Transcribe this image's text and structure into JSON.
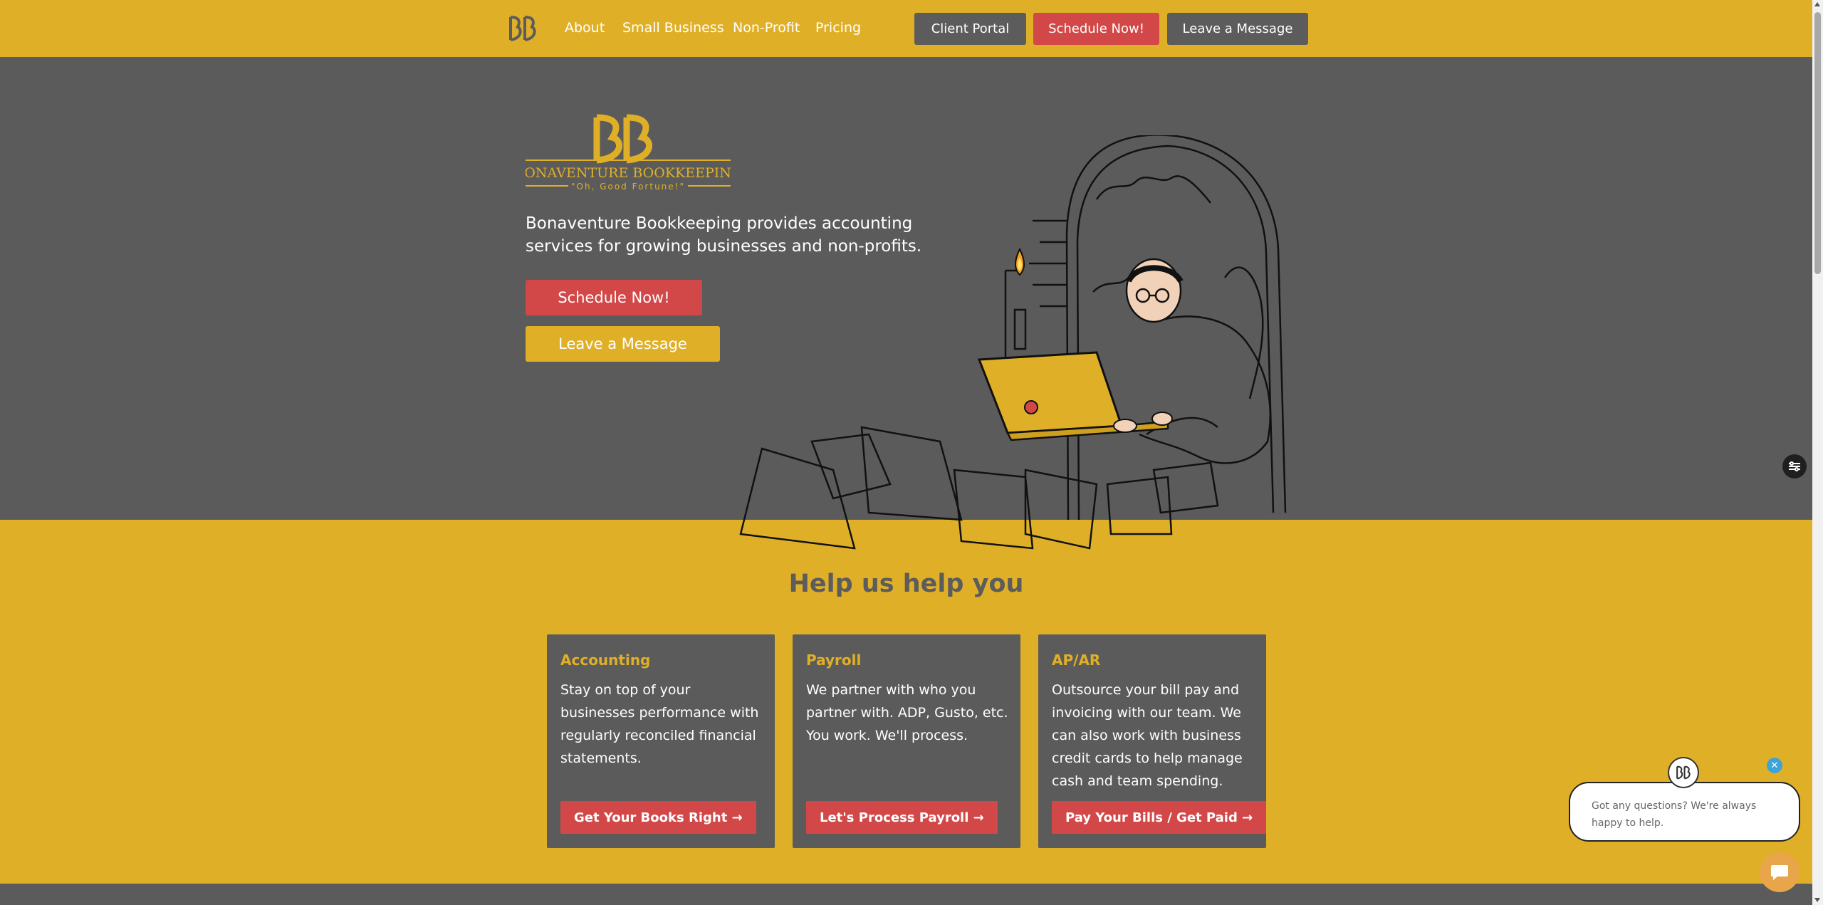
{
  "nav": {
    "logo_icon": "bb-monogram-icon",
    "links": [
      "About",
      "Small Business",
      "Non-Profit",
      "Pricing"
    ],
    "client_portal": "Client Portal",
    "schedule": "Schedule Now!",
    "message": "Leave a Message"
  },
  "hero": {
    "logo_name": "BONAVENTURE BOOKKEEPING",
    "logo_tagline": "\"Oh, Good Fortune!\"",
    "description": "Bonaventure Bookkeeping provides accounting services for growing businesses and non-profits.",
    "schedule_button": "Schedule Now!",
    "message_button": "Leave a Message",
    "illustration": "monk-with-laptop-illustration"
  },
  "help": {
    "title": "Help us help you",
    "cards": [
      {
        "title": "Accounting",
        "body": "Stay on top of your businesses performance with regularly reconciled financial statements.",
        "button": "Get Your Books Right →"
      },
      {
        "title": "Payroll",
        "body": "We partner with who you partner with. ADP, Gusto, etc. You work. We'll process.",
        "button": "Let's Process Payroll →"
      },
      {
        "title": "AP/AR",
        "body": "Outsource your bill pay and invoicing with our team. We can also work with business credit cards to help manage cash and team spending.",
        "button": "Pay Your Bills / Get Paid →"
      }
    ]
  },
  "chat": {
    "message": "Got any questions? We're always happy to help.",
    "close": "✕"
  },
  "colors": {
    "gold": "#dfb027",
    "gray": "#5b5b5b",
    "red": "#d24848"
  }
}
